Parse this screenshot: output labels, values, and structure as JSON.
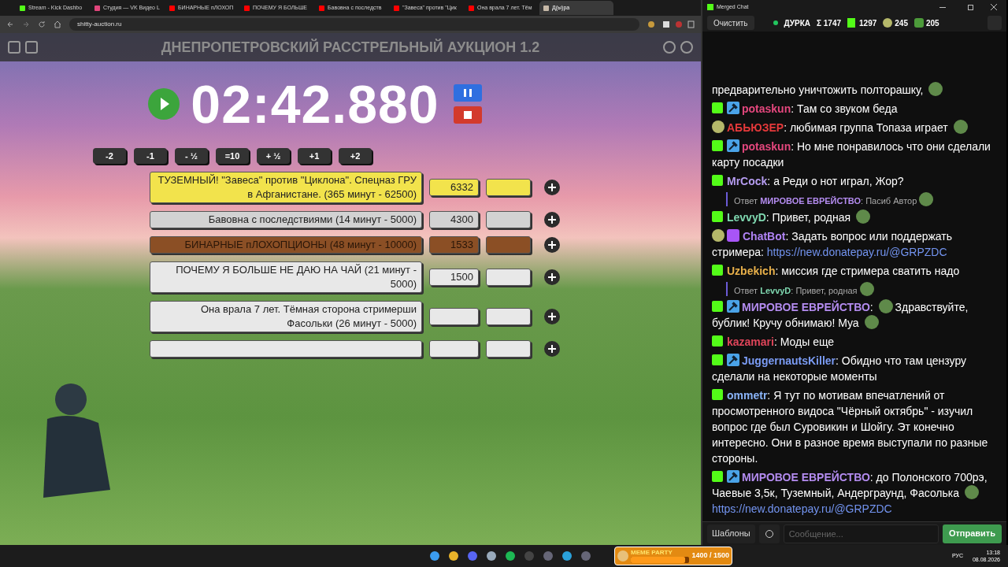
{
  "browser": {
    "tabs": [
      {
        "label": "Stream - Kick Dashbo",
        "kind": "kick",
        "selected": false
      },
      {
        "label": "Студия — VK Видео L",
        "kind": "vk",
        "selected": false
      },
      {
        "label": "БИНАРНЫЕ пЛОХОП",
        "kind": "youtube",
        "selected": false
      },
      {
        "label": "ПОЧЕМУ Я БОЛЬШЕ",
        "kind": "youtube",
        "selected": false
      },
      {
        "label": "Бавовна с последств",
        "kind": "youtube",
        "selected": false
      },
      {
        "label": "\"Завеса\" против \"Цик",
        "kind": "youtube",
        "selected": false
      },
      {
        "label": "Она врала 7 лет. Тём",
        "kind": "youtube",
        "selected": false
      },
      {
        "label": "Д(ы)ра",
        "kind": "page",
        "selected": true
      }
    ],
    "url": "shitty-auction.ru"
  },
  "auction": {
    "title": "ДНЕПРОПЕТРОВСКИЙ РАССТРЕЛЬНЫЙ АУКЦИОН 1.2",
    "timer": "02:42.880",
    "adjust_buttons": [
      "-2",
      "-1",
      "- ½",
      "=10",
      "+ ½",
      "+1",
      "+2"
    ],
    "lots": [
      {
        "title": "ТУЗЕМНЫЙ! \"Завеса\" против \"Циклона\". Спецназ ГРУ в Афганистане. (365 минут - 62500)",
        "amount": "6332",
        "color": "#f2e34c"
      },
      {
        "title": "Бавовна с последствиями (14 минут - 5000)",
        "amount": "4300",
        "color": "#d2d2d2"
      },
      {
        "title": "БИНАРНЫЕ пЛОХОПЦИОНЫ (48 минут - 10000)",
        "amount": "1533",
        "color": "#8b4f25"
      },
      {
        "title": "ПОЧЕМУ Я БОЛЬШЕ НЕ ДАЮ НА ЧАЙ (21 минут - 5000)",
        "amount": "1500",
        "color": "#e8e8e8"
      },
      {
        "title": "Она врала 7 лет. Тёмная сторона стримерши Фасольки (26 минут - 5000)",
        "color": "#e8e8e8"
      },
      {
        "color": "#e8e8e8"
      }
    ]
  },
  "chat": {
    "title": "Merged Chat",
    "clear_button": "Очистить",
    "channel": "ДУРКА",
    "stats": [
      {
        "kind": "sum",
        "text": "Σ 1747"
      },
      {
        "kind": "kick",
        "text": "1297"
      },
      {
        "kind": "emote",
        "text": "245"
      },
      {
        "kind": "frog",
        "text": "205"
      }
    ],
    "messages": [
      {
        "kind": "message",
        "parts": [
          {
            "kind": "text",
            "text": "предварительно уничтожить полторашку,"
          },
          {
            "kind": "emote"
          }
        ]
      },
      {
        "kind": "message",
        "badges": [
          {
            "kind": "kick"
          },
          {
            "kind": "mod"
          }
        ],
        "user": "potaskun",
        "color": "#e4477d",
        "parts": [
          {
            "kind": "text",
            "text": ": Там со звуком беда"
          }
        ]
      },
      {
        "kind": "message",
        "badges": [
          {
            "kind": "emote"
          }
        ],
        "user": "АБЬЮЗЕР",
        "color": "#e5393a",
        "parts": [
          {
            "kind": "text",
            "text": ": любимая группа Топаза играет"
          },
          {
            "kind": "emote"
          }
        ]
      },
      {
        "kind": "message",
        "badges": [
          {
            "kind": "kick"
          },
          {
            "kind": "mod"
          }
        ],
        "user": "potaskun",
        "color": "#e4477d",
        "parts": [
          {
            "kind": "text",
            "text": ": Но мне понравилось что они сделали карту посадки"
          }
        ]
      },
      {
        "kind": "message",
        "badges": [
          {
            "kind": "kick"
          }
        ],
        "user": "MrCock",
        "color": "#b59cf0",
        "parts": [
          {
            "kind": "text",
            "text": ": а Реди о нот играл, Жор?"
          }
        ]
      },
      {
        "kind": "reply",
        "label": "Ответ",
        "user": "МИРОВОЕ ЕВРЕЙСТВО",
        "color": "#b48cf0",
        "text": ": Пасиб Автор"
      },
      {
        "kind": "message",
        "badges": [
          {
            "kind": "kick"
          }
        ],
        "user": "LevvyD",
        "color": "#7fd8b0",
        "parts": [
          {
            "kind": "text",
            "text": ": Привет, родная"
          },
          {
            "kind": "emote"
          }
        ]
      },
      {
        "kind": "message",
        "badges": [
          {
            "kind": "emote"
          },
          {
            "kind": "bot"
          }
        ],
        "user": "ChatBot",
        "color": "#b084f5",
        "parts": [
          {
            "kind": "text",
            "text": ": Задать вопрос или поддержать стримера:"
          },
          {
            "kind": "link",
            "text": "https://new.donatepay.ru/@GRPZDC"
          }
        ]
      },
      {
        "kind": "message",
        "badges": [
          {
            "kind": "kick"
          }
        ],
        "user": "Uzbekich",
        "color": "#e8b04a",
        "parts": [
          {
            "kind": "text",
            "text": ": миссия где стримера сватить надо"
          }
        ]
      },
      {
        "kind": "reply",
        "label": "Ответ",
        "user": "LevvyD",
        "color": "#7fd8b0",
        "text": ": Привет, родная"
      },
      {
        "kind": "message",
        "badges": [
          {
            "kind": "kick"
          },
          {
            "kind": "mod"
          }
        ],
        "user": "МИРОВОЕ ЕВРЕЙСТВО",
        "color": "#b48cf0",
        "parts": [
          {
            "kind": "text",
            "text": ":"
          },
          {
            "kind": "emote"
          },
          {
            "kind": "text",
            "text": "Здравствуйте, бублик! Кручу обнимаю! Муа"
          },
          {
            "kind": "emote"
          }
        ]
      },
      {
        "kind": "message",
        "badges": [
          {
            "kind": "kick"
          }
        ],
        "user": "kazamari",
        "color": "#e0455a",
        "parts": [
          {
            "kind": "text",
            "text": ": Моды еще"
          }
        ]
      },
      {
        "kind": "message",
        "badges": [
          {
            "kind": "kick"
          },
          {
            "kind": "mod"
          }
        ],
        "user": "JuggernautsKiller",
        "color": "#7b9cf5",
        "parts": [
          {
            "kind": "text",
            "text": ": Обидно что там цензуру сделали на некоторые моменты"
          }
        ]
      },
      {
        "kind": "message",
        "badges": [
          {
            "kind": "kick"
          }
        ],
        "user": "ommetr",
        "color": "#8ab4f8",
        "parts": [
          {
            "kind": "text",
            "text": ": Я тут по мотивам впечатлений от просмотренного видоса \"Чёрный октябрь\" - изучил вопрос где был Суровикин и Шойгу. Эт конечно интересно. Они в разное время выступали по разные стороны."
          }
        ]
      },
      {
        "kind": "message",
        "badges": [
          {
            "kind": "kick"
          },
          {
            "kind": "mod"
          }
        ],
        "user": "МИРОВОЕ ЕВРЕЙСТВО",
        "color": "#b48cf0",
        "parts": [
          {
            "kind": "text",
            "text": ": до Полонского 700рэ, Чаевые 3,5к, Туземный, Андерграунд, Фасолька"
          },
          {
            "kind": "emote"
          },
          {
            "kind": "link",
            "text": "https://new.donatepay.ru/@GRPZDC"
          }
        ]
      }
    ],
    "templates_button": "Шаблоны",
    "input": {
      "placeholder": "Сообщение..."
    },
    "send_button": "Отправить"
  },
  "taskbar": {
    "apps": [
      {
        "kind": "windows"
      },
      {
        "kind": "chrome"
      },
      {
        "kind": "discord"
      },
      {
        "kind": "steam"
      },
      {
        "kind": "spotify"
      },
      {
        "kind": "obs"
      },
      {
        "kind": "app"
      },
      {
        "kind": "telegram"
      },
      {
        "kind": "app"
      }
    ],
    "widget": {
      "title": "MEME PARTY",
      "reading": "1400 / 1500",
      "level": 0.93
    },
    "language": "РУС",
    "time": "13:18",
    "date": "08.08.2026"
  }
}
